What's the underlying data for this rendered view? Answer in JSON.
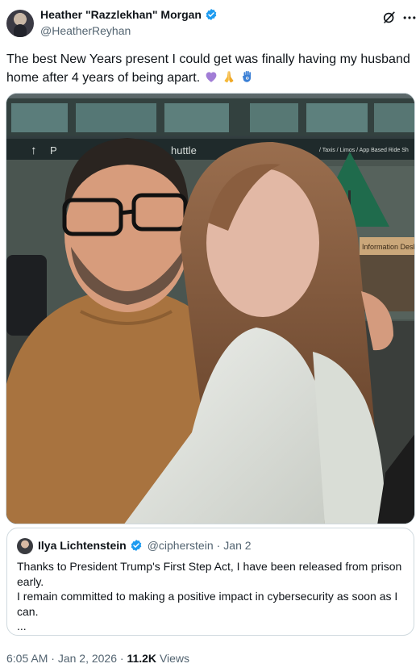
{
  "author": {
    "display_name": "Heather \"Razzlekhan\" Morgan",
    "handle": "@HeatherReyhan",
    "verified": true
  },
  "header_icons": {
    "grok": "grok-icon",
    "more": "more-icon"
  },
  "tweet": {
    "text": "The best New Years present I could get was finally having my husband home after 4 years of being apart.",
    "emojis": [
      "purple-heart-emoji",
      "folded-hands-emoji",
      "hamsa-emoji"
    ]
  },
  "photo": {
    "signs": {
      "arrow_left_text": "P",
      "shuttle": "huttle",
      "taxis": "/ Taxis / Limos / App Based Ride Sh",
      "info_desk": "Information Desk"
    }
  },
  "quote": {
    "display_name": "Ilya Lichtenstein",
    "verified": true,
    "handle": "@cipherstein",
    "sep": "·",
    "date": "Jan 2",
    "line1": "Thanks to President Trump's First Step Act, I have been released from prison early.",
    "line2": "I remain committed to making a positive impact in cybersecurity as soon as I can.",
    "ellipsis": "..."
  },
  "meta": {
    "time": "6:05 AM",
    "sep1": "·",
    "date": "Jan 2, 2026",
    "sep2": "·",
    "views_count": "11.2K",
    "views_label": "Views"
  },
  "colors": {
    "verified_blue": "#1d9bf0",
    "secondary_text": "#536471",
    "border": "#cfd9de"
  }
}
